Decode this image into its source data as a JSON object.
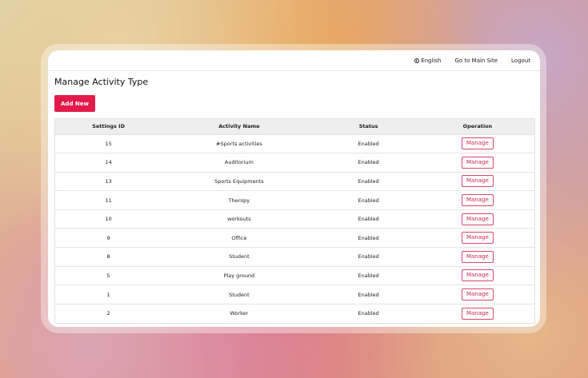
{
  "topbar": {
    "language": "English",
    "main_site": "Go to Main Site",
    "logout": "Logout"
  },
  "page": {
    "title": "Manage Activity Type",
    "add_button": "Add New"
  },
  "table": {
    "headers": [
      "Settings ID",
      "Activity Name",
      "Status",
      "Operation"
    ],
    "rows": [
      {
        "id": "15",
        "name": "#Sports activities",
        "status": "Enabled",
        "action": "Manage"
      },
      {
        "id": "14",
        "name": "Auditorium",
        "status": "Enabled",
        "action": "Manage"
      },
      {
        "id": "13",
        "name": "Sports Equipments",
        "status": "Enabled",
        "action": "Manage"
      },
      {
        "id": "11",
        "name": "Theropy",
        "status": "Enabled",
        "action": "Manage"
      },
      {
        "id": "10",
        "name": "workouts",
        "status": "Enabled",
        "action": "Manage"
      },
      {
        "id": "9",
        "name": "Office",
        "status": "Enabled",
        "action": "Manage"
      },
      {
        "id": "8",
        "name": "Student",
        "status": "Enabled",
        "action": "Manage"
      },
      {
        "id": "5",
        "name": "Play ground",
        "status": "Enabled",
        "action": "Manage"
      },
      {
        "id": "1",
        "name": "Student",
        "status": "Enabled",
        "action": "Manage"
      },
      {
        "id": "2",
        "name": "Worker",
        "status": "Enabled",
        "action": "Manage"
      }
    ]
  },
  "colors": {
    "accent": "#e31b4a",
    "manage_border": "#d9476a"
  },
  "icons": {
    "language": "globe-icon"
  }
}
